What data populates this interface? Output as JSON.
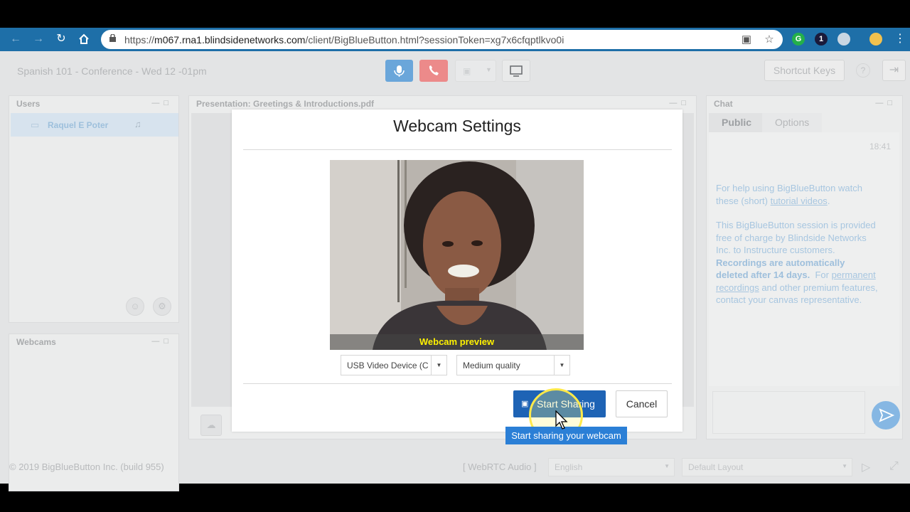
{
  "browser": {
    "url_prefix": "https://",
    "url_host": "m067.rna1.blindsidenetworks.com",
    "url_path": "/client/BigBlueButton.html?sessionToken=xg7x6cfqptlkvo0i",
    "ext_g": "G",
    "ext_one": "1"
  },
  "app": {
    "conference_title": "Spanish 101 - Conference - Wed 12 -01pm",
    "shortcut_keys_label": "Shortcut Keys",
    "colors": {
      "primary": "#1e63b5",
      "hangup": "#e26a6a",
      "mic": "#5b9bd5"
    }
  },
  "users_panel": {
    "title": "Users",
    "user_name": "Raquel E Poter"
  },
  "webcams_panel": {
    "title": "Webcams"
  },
  "presentation": {
    "title": "Presentation: Greetings & Introductions.pdf"
  },
  "chat": {
    "title": "Chat",
    "tabs": [
      "Public",
      "Options"
    ],
    "timestamp": "18:41",
    "help_line1": "For help using BigBlueButton watch",
    "help_line2_pre": "these (short) ",
    "help_link": "tutorial videos",
    "help_line2_post": ".",
    "info_line1": "This BigBlueButton session is provided",
    "info_line2": "free of charge by Blindside Networks",
    "info_line3": "Inc. to Instructure customers.",
    "bold_line1": "Recordings are automatically",
    "bold_line2": "deleted after 14 days.",
    "for_text": "  For ",
    "link1": "permanent",
    "link2": "recordings",
    "after_link": " and other premium features,",
    "last_line": "contact your canvas representative."
  },
  "footer": {
    "copyright": "© 2019 BigBlueButton Inc. (build 955)",
    "audio_status": "[ WebRTC Audio ]",
    "language": "English",
    "layout": "Default Layout"
  },
  "modal": {
    "title": "Webcam Settings",
    "preview_caption": "Webcam preview",
    "device_select": "USB Video Device (C",
    "quality_select": "Medium quality",
    "start_label": "Start Sharing",
    "cancel_label": "Cancel",
    "tooltip": "Start sharing your webcam"
  }
}
